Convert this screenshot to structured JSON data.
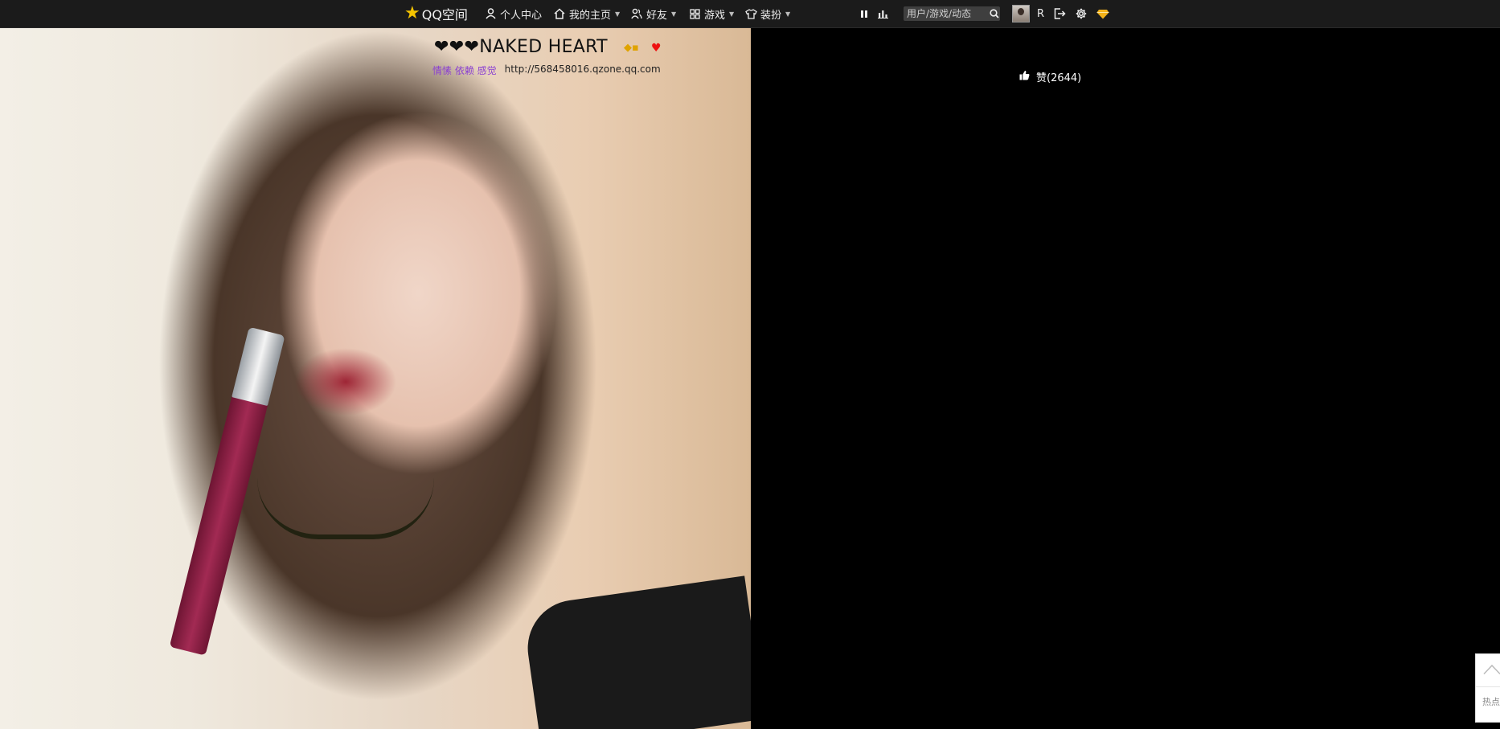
{
  "topbar": {
    "logo_label": "QQ空间",
    "nav": [
      {
        "label": "个人中心",
        "icon": "user-icon"
      },
      {
        "label": "我的主页",
        "icon": "home-icon"
      },
      {
        "label": "好友",
        "icon": "friends-icon"
      },
      {
        "label": "游戏",
        "icon": "apps-grid-icon"
      },
      {
        "label": "装扮",
        "icon": "shirt-icon"
      }
    ],
    "search_placeholder": "用户/游戏/动态",
    "user_initial": "R"
  },
  "profile": {
    "title": "❤❤❤NAKED HEART",
    "description": "情愫 依赖 感觉",
    "url": "http://568458016.qzone.qq.com"
  },
  "like": {
    "label": "赞(2644)"
  },
  "float_panel": {
    "hot_label": "热点"
  },
  "colors": {
    "topbar_bg": "#1b1b1b",
    "logo_star": "#f5c400",
    "description": "#8a3fd1"
  }
}
